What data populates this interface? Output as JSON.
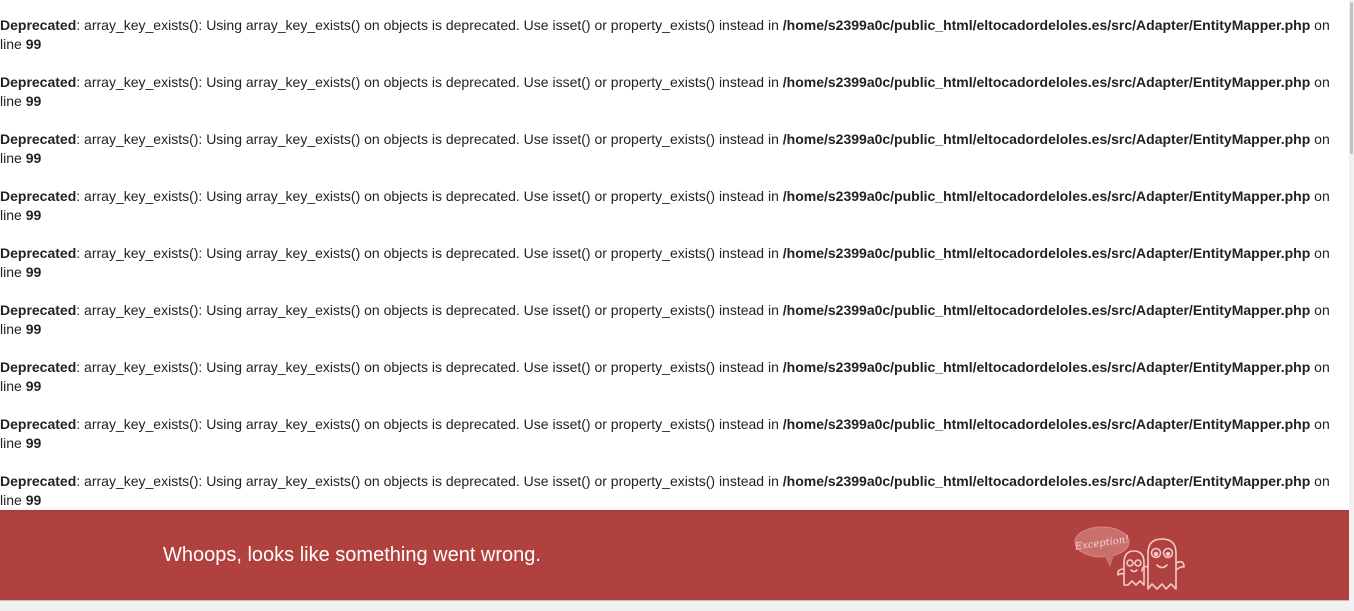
{
  "notices": [
    {
      "level": "Deprecated",
      "message": ": array_key_exists(): Using array_key_exists() on objects is deprecated. Use isset() or property_exists() instead in ",
      "file": "/home/s2399a0c/public_html/eltocadordeloles.es/src/Adapter/EntityMapper.php",
      "on_line": " on line ",
      "line": "99"
    },
    {
      "level": "Deprecated",
      "message": ": array_key_exists(): Using array_key_exists() on objects is deprecated. Use isset() or property_exists() instead in ",
      "file": "/home/s2399a0c/public_html/eltocadordeloles.es/src/Adapter/EntityMapper.php",
      "on_line": " on line ",
      "line": "99"
    },
    {
      "level": "Deprecated",
      "message": ": array_key_exists(): Using array_key_exists() on objects is deprecated. Use isset() or property_exists() instead in ",
      "file": "/home/s2399a0c/public_html/eltocadordeloles.es/src/Adapter/EntityMapper.php",
      "on_line": " on line ",
      "line": "99"
    },
    {
      "level": "Deprecated",
      "message": ": array_key_exists(): Using array_key_exists() on objects is deprecated. Use isset() or property_exists() instead in ",
      "file": "/home/s2399a0c/public_html/eltocadordeloles.es/src/Adapter/EntityMapper.php",
      "on_line": " on line ",
      "line": "99"
    },
    {
      "level": "Deprecated",
      "message": ": array_key_exists(): Using array_key_exists() on objects is deprecated. Use isset() or property_exists() instead in ",
      "file": "/home/s2399a0c/public_html/eltocadordeloles.es/src/Adapter/EntityMapper.php",
      "on_line": " on line ",
      "line": "99"
    },
    {
      "level": "Deprecated",
      "message": ": array_key_exists(): Using array_key_exists() on objects is deprecated. Use isset() or property_exists() instead in ",
      "file": "/home/s2399a0c/public_html/eltocadordeloles.es/src/Adapter/EntityMapper.php",
      "on_line": " on line ",
      "line": "99"
    },
    {
      "level": "Deprecated",
      "message": ": array_key_exists(): Using array_key_exists() on objects is deprecated. Use isset() or property_exists() instead in ",
      "file": "/home/s2399a0c/public_html/eltocadordeloles.es/src/Adapter/EntityMapper.php",
      "on_line": " on line ",
      "line": "99"
    },
    {
      "level": "Deprecated",
      "message": ": array_key_exists(): Using array_key_exists() on objects is deprecated. Use isset() or property_exists() instead in ",
      "file": "/home/s2399a0c/public_html/eltocadordeloles.es/src/Adapter/EntityMapper.php",
      "on_line": " on line ",
      "line": "99"
    },
    {
      "level": "Deprecated",
      "message": ": array_key_exists(): Using array_key_exists() on objects is deprecated. Use isset() or property_exists() instead in ",
      "file": "/home/s2399a0c/public_html/eltocadordeloles.es/src/Adapter/EntityMapper.php",
      "on_line": " on line ",
      "line": "99"
    }
  ],
  "error_banner": {
    "message": "Whoops, looks like something went wrong.",
    "badge_text": "Exception!",
    "mascot_icon": "ghost-mascot-icon",
    "background_color": "#b0413e"
  }
}
